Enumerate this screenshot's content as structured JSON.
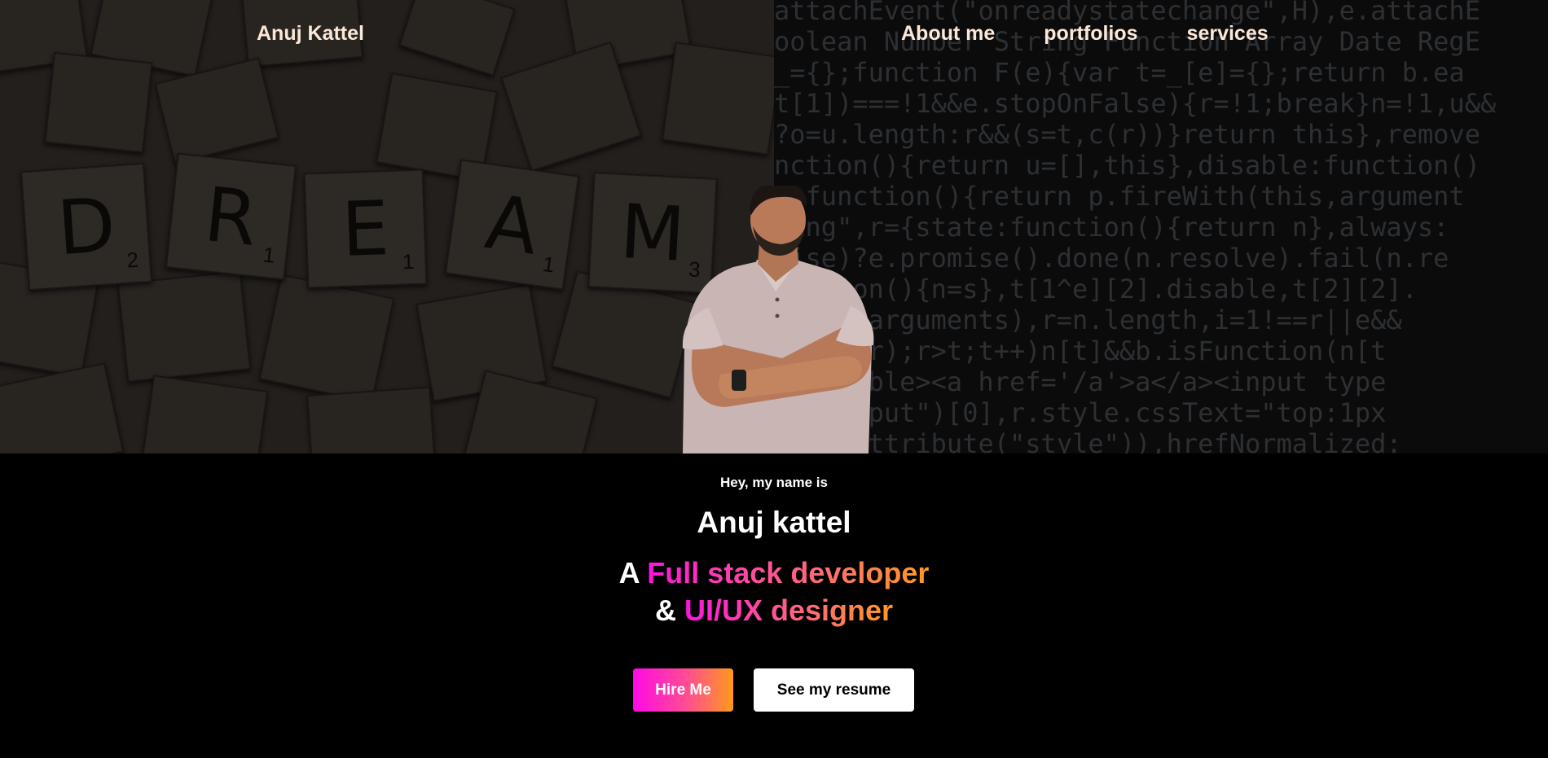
{
  "nav": {
    "brand": "Anuj Kattel",
    "links": [
      "About me",
      "portfolios",
      "services"
    ]
  },
  "hero": {
    "tiles": [
      {
        "letter": "D",
        "score": "2"
      },
      {
        "letter": "R",
        "score": "1"
      },
      {
        "letter": "E",
        "score": "1"
      },
      {
        "letter": "A",
        "score": "1"
      },
      {
        "letter": "M",
        "score": "3"
      }
    ],
    "code_lines": [
      "attachEvent(\"onreadystatechange\",H),e.attachE",
      "oolean Number String Function Array Date RegE",
      "_={};function F(e){var t=_[e]={};return b.ea",
      "t[1])===!1&&e.stopOnFalse){r=!1;break}n=!1,u&&",
      "?o=u.length:r&&(s=t,c(r))}return this},remove",
      "nction(){return u=[],this},disable:function()",
      "e:function(){return p.fireWith(this,argument",
      "ding\",r={state:function(){return n},always:",
      "mise)?e.promise().done(n.resolve).fail(n.re",
      "unction(){n=s},t[1^e][2].disable,t[2][2].",
      ".call(arguments),r=n.length,i=1!==r||e&&",
      "Array(r);r>t;t++)n[t]&&b.isFunction(n[t",
      "e></table><a href='/a'>a</a><input type",
      "me(\"input\")[0],r.style.cssText=\"top:1px",
      "r.getAttribute(\"style\")),hrefNormalized:"
    ]
  },
  "intro": {
    "greeting": "Hey, my name is",
    "name": "Anuj kattel",
    "role_line1_prefix": "A ",
    "role_line1_highlight": "Full stack developer",
    "role_line2_prefix": "& ",
    "role_line2_highlight": "UI/UX designer"
  },
  "buttons": {
    "hire": "Hire Me",
    "resume": "See my resume"
  },
  "colors": {
    "gradient_start": "#ff13e0",
    "gradient_mid": "#ff5e8a",
    "gradient_end": "#ff9a1f",
    "nav_text": "#fbe8d8",
    "background": "#000000"
  }
}
